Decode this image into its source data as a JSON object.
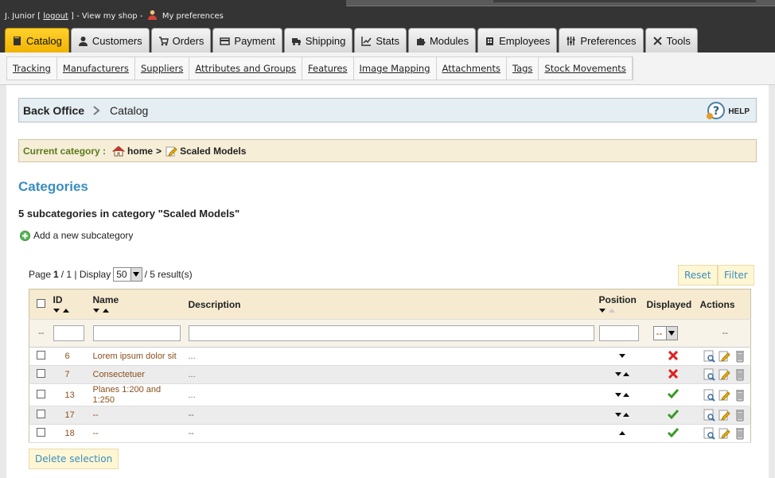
{
  "userbar": {
    "user": "J. Junior [",
    "logout": "logout",
    "mid": "] - View my shop -",
    "prefs": "My preferences"
  },
  "tabs": [
    {
      "label": "Catalog",
      "icon": "book-icon",
      "active": true
    },
    {
      "label": "Customers",
      "icon": "person-icon"
    },
    {
      "label": "Orders",
      "icon": "cart-icon"
    },
    {
      "label": "Payment",
      "icon": "card-icon"
    },
    {
      "label": "Shipping",
      "icon": "truck-icon"
    },
    {
      "label": "Stats",
      "icon": "chart-icon"
    },
    {
      "label": "Modules",
      "icon": "puzzle-icon"
    },
    {
      "label": "Employees",
      "icon": "building-icon"
    },
    {
      "label": "Preferences",
      "icon": "sliders-icon"
    },
    {
      "label": "Tools",
      "icon": "tools-icon"
    }
  ],
  "subnav": [
    "Tracking",
    "Manufacturers",
    "Suppliers",
    "Attributes and Groups",
    "Features",
    "Image Mapping",
    "Attachments",
    "Tags",
    "Stock Movements"
  ],
  "breadcrumb": {
    "root": "Back Office",
    "current": "Catalog",
    "help": "HELP"
  },
  "current_category": {
    "label": "Current category :",
    "home": "home",
    "separator": ">",
    "category": "Scaled Models"
  },
  "heading": "Categories",
  "subcount": "5 subcategories in category \"Scaled Models\"",
  "add_new": "Add a new subcategory",
  "pager": {
    "page_label": "Page",
    "page": "1",
    "of": "/ 1 | Display",
    "display": "50",
    "results": "/ 5 result(s)"
  },
  "buttons": {
    "reset": "Reset",
    "filter": "Filter",
    "delete": "Delete selection"
  },
  "table": {
    "headers": {
      "id": "ID",
      "name": "Name",
      "description": "Description",
      "position": "Position",
      "displayed": "Displayed",
      "actions": "Actions"
    },
    "filter": {
      "dash": "--",
      "displayed_select": "--",
      "actions_dash": "--"
    },
    "rows": [
      {
        "id": "6",
        "name": "Lorem ipsum dolor sit",
        "description": "...",
        "pos": "down",
        "displayed": false
      },
      {
        "id": "7",
        "name": "Consectetuer",
        "description": "...",
        "pos": "both",
        "displayed": false
      },
      {
        "id": "13",
        "name": "Planes 1:200 and 1:250",
        "description": "...",
        "pos": "both",
        "displayed": true
      },
      {
        "id": "17",
        "name": "--",
        "description": "--",
        "pos": "both",
        "displayed": true
      },
      {
        "id": "18",
        "name": "--",
        "description": "--",
        "pos": "up",
        "displayed": true
      }
    ]
  },
  "colors": {
    "accent": "#3a8dc0",
    "tab_active": "#f1b200",
    "row_text": "#8b4f1b"
  }
}
